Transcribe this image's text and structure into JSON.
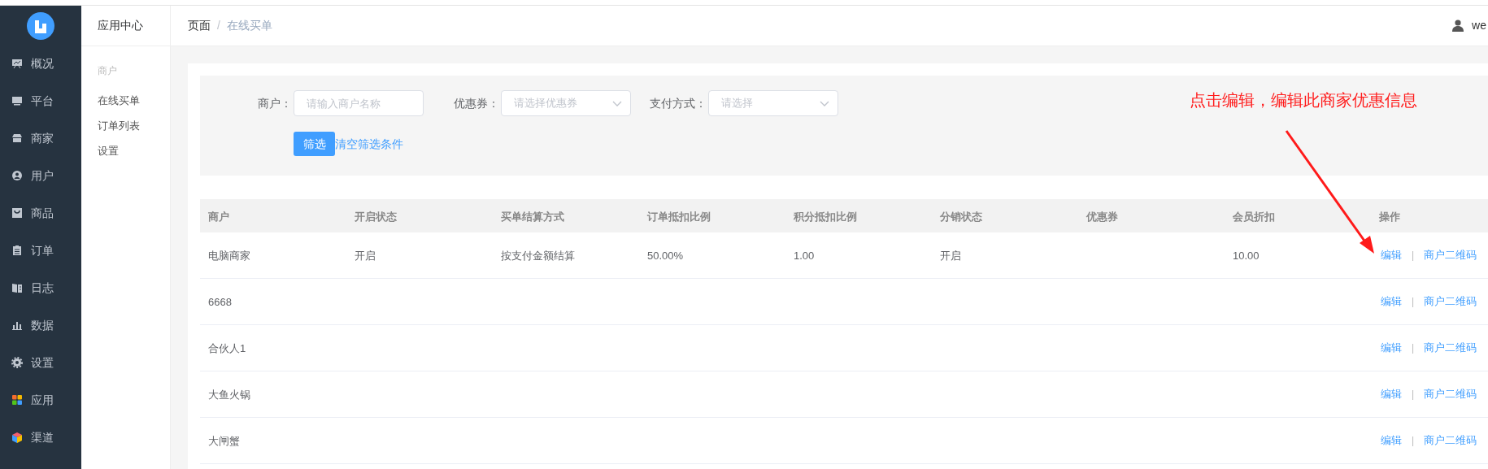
{
  "sidebar": {
    "items": [
      {
        "label": "概况"
      },
      {
        "label": "平台"
      },
      {
        "label": "商家"
      },
      {
        "label": "用户"
      },
      {
        "label": "商品"
      },
      {
        "label": "订单"
      },
      {
        "label": "日志"
      },
      {
        "label": "数据"
      },
      {
        "label": "设置"
      },
      {
        "label": "应用"
      },
      {
        "label": "渠道"
      }
    ]
  },
  "submenu": {
    "title": "应用中心",
    "group": "商户",
    "items": [
      {
        "label": "在线买单"
      },
      {
        "label": "订单列表"
      },
      {
        "label": "设置"
      }
    ]
  },
  "header": {
    "breadcrumb": [
      "页面",
      "在线买单"
    ],
    "separator": "/",
    "user": "we"
  },
  "filters": [
    {
      "kind": "input",
      "label": "商户：",
      "placeholder": "请输入商户名称"
    },
    {
      "kind": "select",
      "label": "优惠券：",
      "placeholder": "请选择优惠券"
    },
    {
      "kind": "select",
      "label": "支付方式：",
      "placeholder": "请选择"
    }
  ],
  "filter_button": "筛选",
  "clear_link": "清空筛选条件",
  "annotation": "点击编辑，编辑此商家优惠信息",
  "table": {
    "columns": [
      "商户",
      "开启状态",
      "买单结算方式",
      "订单抵扣比例",
      "积分抵扣比例",
      "分销状态",
      "优惠券",
      "会员折扣",
      "操作"
    ],
    "rows": [
      {
        "cells": [
          "电脑商家",
          "开启",
          "按支付金额结算",
          "50.00%",
          "1.00",
          "开启",
          "",
          "10.00"
        ],
        "actions": [
          "编辑",
          "商户二维码"
        ],
        "separator": "|"
      },
      {
        "cells": [
          "6668"
        ],
        "actions": [
          "编辑",
          "商户二维码"
        ],
        "separator": "|"
      },
      {
        "cells": [
          "合伙人1"
        ],
        "actions": [
          "编辑",
          "商户二维码"
        ],
        "separator": "|"
      },
      {
        "cells": [
          "大鱼火锅"
        ],
        "actions": [
          "编辑",
          "商户二维码"
        ],
        "separator": "|"
      },
      {
        "cells": [
          "大闸蟹"
        ],
        "actions": [
          "编辑",
          "商户二维码"
        ],
        "separator": "|"
      }
    ]
  }
}
